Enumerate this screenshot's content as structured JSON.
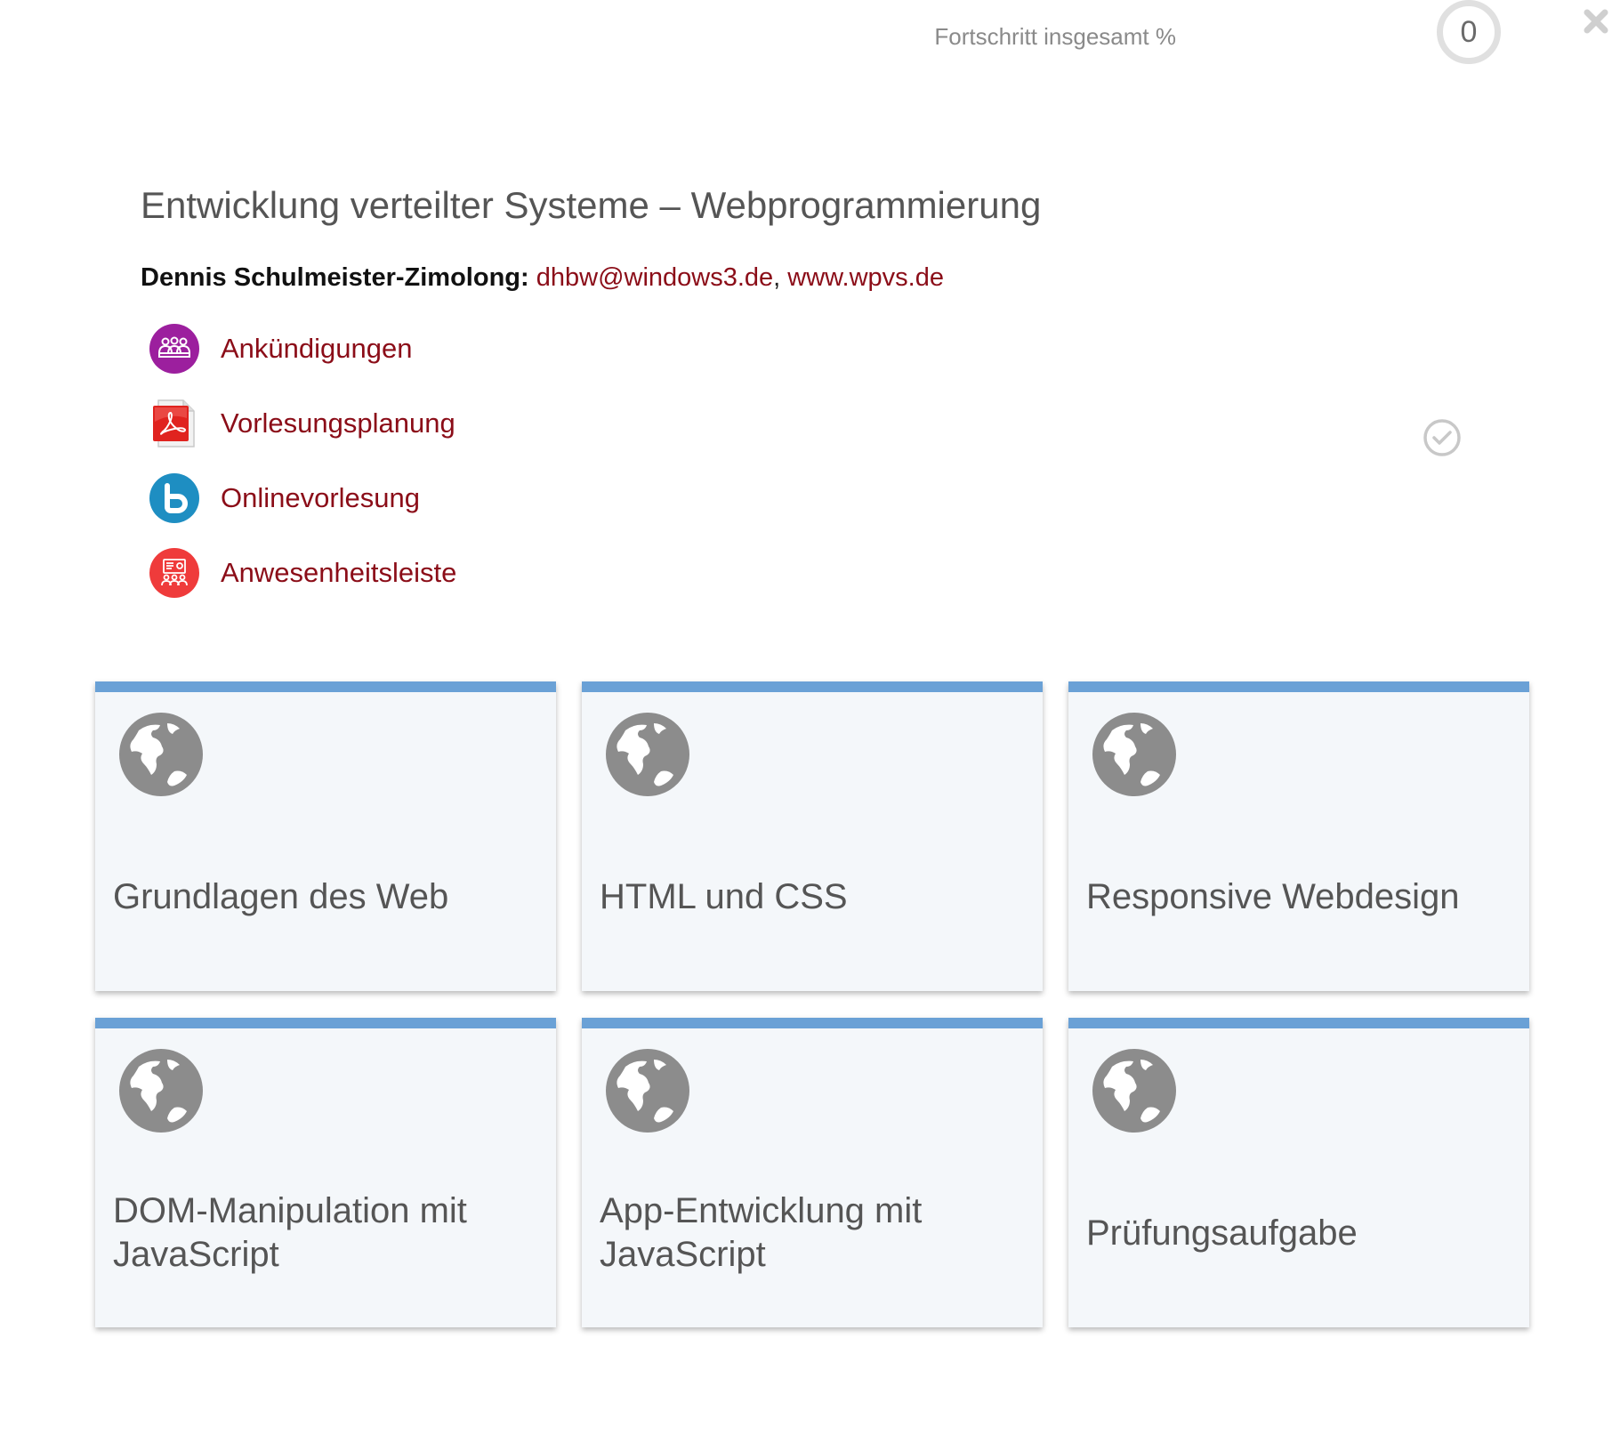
{
  "header": {
    "progress_label": "Fortschritt insgesamt %",
    "progress_value": "0",
    "close_icon": "close-icon"
  },
  "course": {
    "title": "Entwicklung verteilter Systeme – Webprogrammierung",
    "instructor_name": "Dennis Schulmeister-Zimolong:",
    "email": "dhbw@windows3.de",
    "separator": ", ",
    "website": "www.wpvs.de"
  },
  "activities": [
    {
      "label": "Ankündigungen",
      "icon": "forum-users-icon",
      "color": "#9c1f9e"
    },
    {
      "label": "Vorlesungsplanung",
      "icon": "pdf-file-icon",
      "color": "#d42a2a"
    },
    {
      "label": "Onlinevorlesung",
      "icon": "bigbluebutton-icon",
      "color": "#1e8ec2"
    },
    {
      "label": "Anwesenheitsleiste",
      "icon": "attendance-icon",
      "color": "#ef3b3b"
    }
  ],
  "completion": {
    "icon": "check-circle-icon",
    "completed": false
  },
  "tiles": [
    {
      "title": "Grundlagen des Web",
      "icon": "globe-icon"
    },
    {
      "title": "HTML und CSS",
      "icon": "globe-icon"
    },
    {
      "title": "Responsive Webdesign",
      "icon": "globe-icon"
    },
    {
      "title": "DOM-Manipulation mit JavaScript",
      "icon": "globe-icon"
    },
    {
      "title": "App-Entwicklung mit JavaScript",
      "icon": "globe-icon"
    },
    {
      "title": "Prüfungsaufgabe",
      "icon": "globe-icon"
    }
  ],
  "colors": {
    "link": "#8b0d18",
    "tile_accent": "#6aa1d6",
    "tile_background": "#f4f7fa",
    "globe": "#8c8c8c"
  }
}
